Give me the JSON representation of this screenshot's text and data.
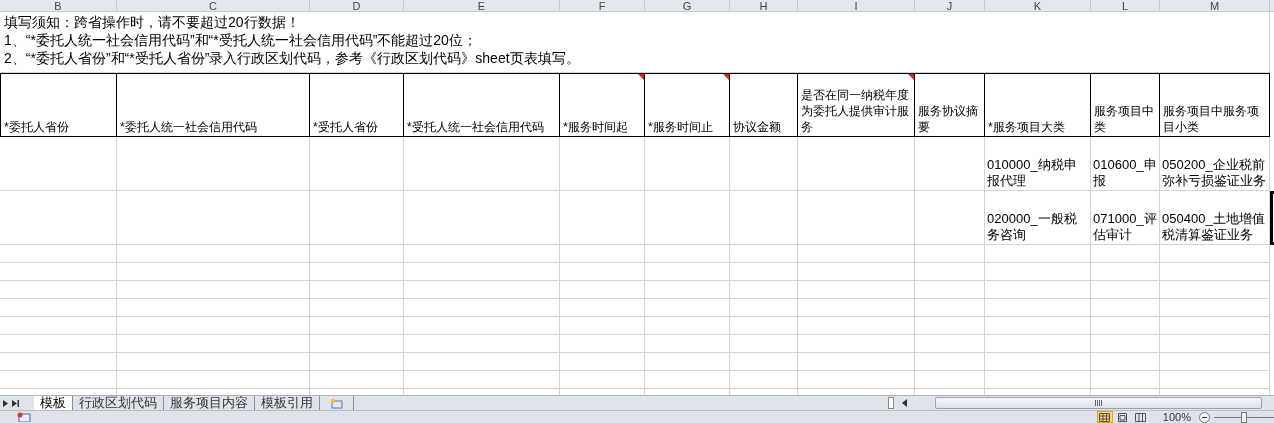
{
  "columns": [
    "B",
    "C",
    "D",
    "E",
    "F",
    "G",
    "H",
    "I",
    "J",
    "K",
    "L",
    "M"
  ],
  "notice": [
    "填写须知：跨省操作时，请不要超过20行数据！",
    "1、“*委托人统一社会信用代码”和“*受托人统一社会信用代码”不能超过20位；",
    "2、“*委托人省份”和“*受托人省份”录入行政区划代码，参考《行政区划代码》sheet页表填写。"
  ],
  "headers": [
    {
      "text": "*委托人省份",
      "comment": false
    },
    {
      "text": "*委托人统一社会信用代码",
      "comment": false
    },
    {
      "text": "*受托人省份",
      "comment": false
    },
    {
      "text": "*受托人统一社会信用代码",
      "comment": false
    },
    {
      "text": "*服务时间起",
      "comment": true
    },
    {
      "text": "*服务时间止",
      "comment": true
    },
    {
      "text": "协议金额",
      "comment": false
    },
    {
      "text": "是否在同一纳税年度为委托人提供审计服务",
      "comment": true
    },
    {
      "text": "服务协议摘要",
      "comment": false
    },
    {
      "text": "*服务项目大类",
      "comment": false
    },
    {
      "text": "服务项目中类",
      "comment": false
    },
    {
      "text": "服务项目中服务项目小类",
      "comment": false
    }
  ],
  "rows": [
    {
      "service_category": "010000_纳税申报代理",
      "service_middle": "010600_申报",
      "service_minor": "050200_企业税前弥补亏损鉴证业务",
      "selected": false
    },
    {
      "service_category": "020000_一般税务咨询",
      "service_middle": "071000_评估审计",
      "service_minor": "050400_土地增值税清算鉴证业务",
      "selected": true
    }
  ],
  "sheet_tabs": [
    {
      "label": "模板",
      "selected": true
    },
    {
      "label": "行政区划代码",
      "selected": false
    },
    {
      "label": "服务项目内容",
      "selected": false
    },
    {
      "label": "模板引用",
      "selected": false
    }
  ],
  "status_bar": {
    "views": [
      {
        "kind": "normal",
        "selected": true
      },
      {
        "kind": "layout",
        "selected": false
      },
      {
        "kind": "pagebreak",
        "selected": false
      }
    ],
    "zoom": "100%",
    "zoom_slider": {
      "level": 0.5
    }
  }
}
